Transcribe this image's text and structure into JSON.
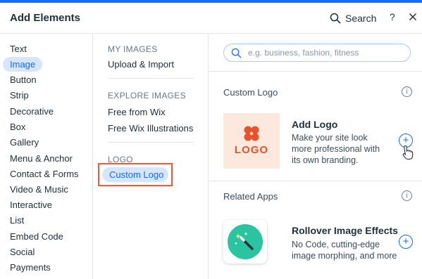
{
  "header": {
    "title": "Add Elements",
    "search_label": "Search",
    "help_label": "?"
  },
  "categories": [
    {
      "label": "Text"
    },
    {
      "label": "Image",
      "active": true
    },
    {
      "label": "Button"
    },
    {
      "label": "Strip"
    },
    {
      "label": "Decorative"
    },
    {
      "label": "Box"
    },
    {
      "label": "Gallery"
    },
    {
      "label": "Menu & Anchor"
    },
    {
      "label": "Contact & Forms"
    },
    {
      "label": "Video & Music"
    },
    {
      "label": "Interactive"
    },
    {
      "label": "List"
    },
    {
      "label": "Embed Code"
    },
    {
      "label": "Social"
    },
    {
      "label": "Payments"
    }
  ],
  "subnav": {
    "my_images": {
      "heading": "MY IMAGES",
      "items": [
        "Upload & Import"
      ]
    },
    "explore_images": {
      "heading": "EXPLORE IMAGES",
      "items": [
        "Free from Wix",
        "Free Wix Illustrations"
      ]
    },
    "logo": {
      "heading": "LOGO",
      "items": [
        "Custom Logo"
      ]
    }
  },
  "content": {
    "search_placeholder": "e.g. business, fashion, fitness",
    "custom_logo_section": {
      "heading": "Custom Logo",
      "card": {
        "thumb_text": "LOGO",
        "title": "Add Logo",
        "description": [
          "Make your site look",
          "more professional with",
          "its own branding."
        ]
      }
    },
    "related_apps_section": {
      "heading": "Related Apps",
      "card": {
        "title": "Rollover Image Effects",
        "description": [
          "No Code, cutting-edge",
          "image morphing, and more"
        ]
      }
    }
  },
  "colors": {
    "accent": "#116dff",
    "highlight_border": "#ef5a37",
    "logo_orange": "#e8512a",
    "logo_bg": "#fde8dd",
    "app_teal": "#2bc4a0"
  },
  "icons": [
    "search-icon",
    "close-icon",
    "info-icon",
    "plus-icon",
    "clover-logo-icon",
    "magic-wand-icon",
    "hand-pointer-cursor"
  ]
}
